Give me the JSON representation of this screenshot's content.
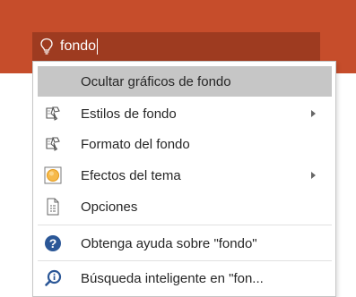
{
  "tell_me": {
    "value": "fondo",
    "icon": "lightbulb-icon"
  },
  "menu": {
    "items": [
      {
        "label": "Ocultar gráficos de fondo",
        "icon": "",
        "submenu": false,
        "highlighted": true
      },
      {
        "label": "Estilos de fondo",
        "icon": "background-styles-icon",
        "submenu": true
      },
      {
        "label": "Formato del fondo",
        "icon": "format-background-icon",
        "submenu": false
      },
      {
        "label": "Efectos del tema",
        "icon": "theme-effects-icon",
        "submenu": true
      },
      {
        "label": "Opciones",
        "icon": "options-document-icon",
        "submenu": false
      },
      {
        "label": "Obtenga ayuda sobre \"fondo\"",
        "icon": "help-icon",
        "submenu": false
      },
      {
        "label": "Búsqueda inteligente en \"fon...",
        "icon": "smart-lookup-icon",
        "submenu": false
      }
    ]
  },
  "colors": {
    "titlebar": "#c64d2b",
    "search_box": "#9e3b20",
    "highlight": "#c6c6c6",
    "help_blue": "#2b5797"
  }
}
